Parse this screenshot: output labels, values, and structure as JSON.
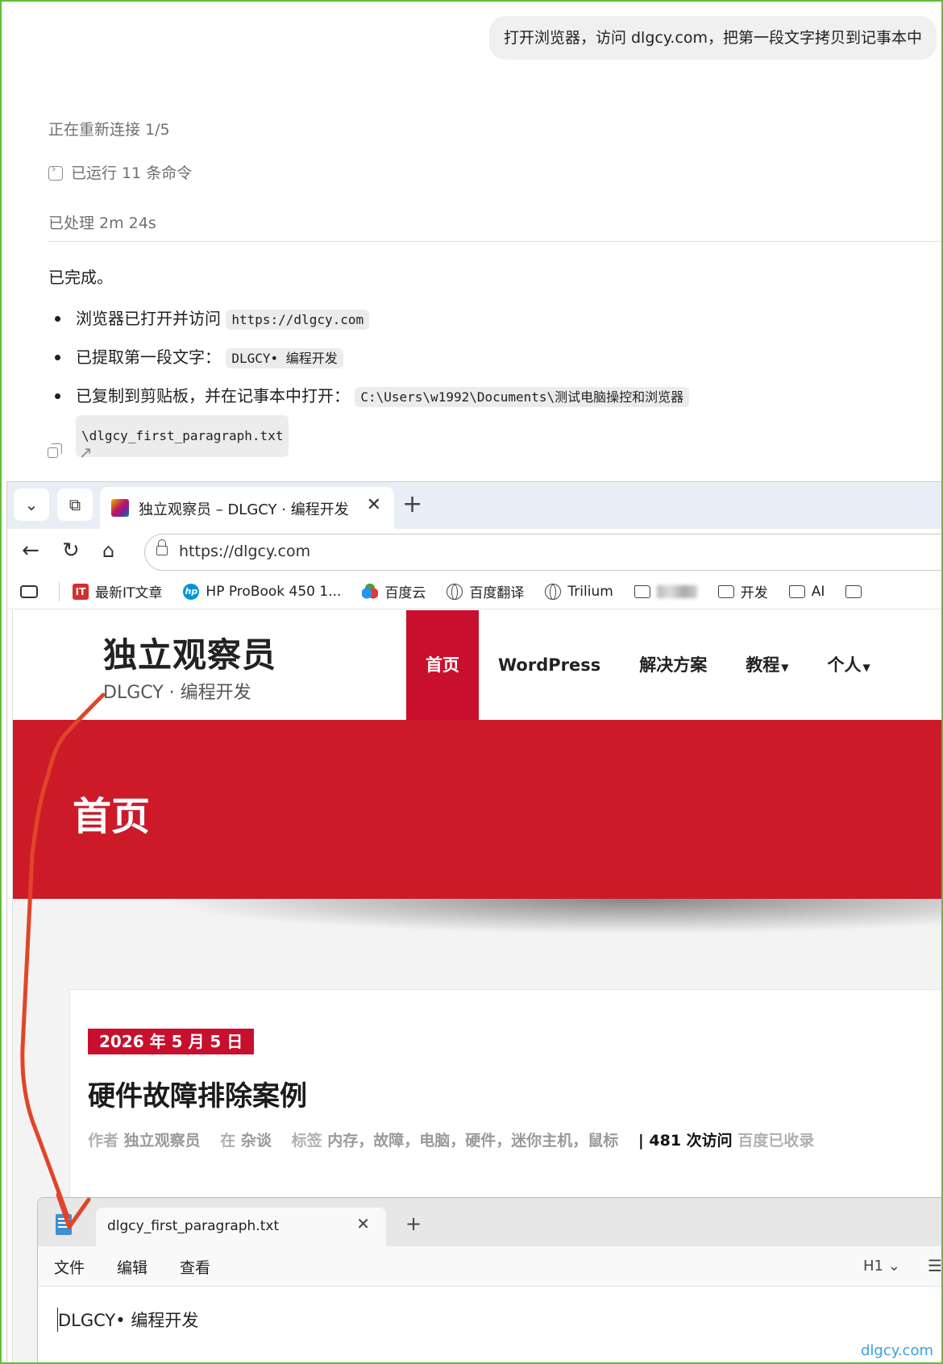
{
  "chat": {
    "user_message": "打开浏览器，访问 dlgcy.com，把第一段文字拷贝到记事本中",
    "reconnecting": "正在重新连接 1/5",
    "commands_ran": "已运行 11 条命令",
    "processed": "已处理 2m 24s",
    "completed": "已完成。",
    "bullets": {
      "b1_text": "浏览器已打开并访问",
      "b1_code": "https://dlgcy.com",
      "b2_text": "已提取第一段文字：",
      "b2_code": "DLGCY• 编程开发",
      "b3_text": "已复制到剪贴板，并在记事本中打开：",
      "b3_code_line1": "C:\\Users\\w1992\\Documents\\测试电脑操控和浏览器",
      "b3_code_line2": "\\dlgcy_first_paragraph.txt"
    }
  },
  "browser": {
    "tab_title": "独立观察员 – DLGCY · 编程开发",
    "new_tab": "+",
    "url": "https://dlgcy.com",
    "bookmarks": [
      "最新IT文章",
      "HP ProBook 450 1...",
      "百度云",
      "百度翻译",
      "Trilium",
      "开发",
      "AI"
    ],
    "icons": {
      "it_icon": "IT",
      "hp_icon": "hp"
    }
  },
  "site": {
    "logo_title": "独立观察员",
    "logo_sub": "DLGCY · 编程开发",
    "menu": [
      "首页",
      "WordPress",
      "解决方案",
      "教程",
      "个人"
    ],
    "banner_title": "首页",
    "post": {
      "date": "2026 年 5 月 5 日",
      "title": "硬件故障排除案例",
      "author_label": "作者",
      "author": "独立观察员",
      "in_label": "在",
      "category": "杂谈",
      "tags_label": "标签",
      "tags": "内存，故障，电脑，硬件，迷你主机，鼠标",
      "views": "| 481 次访问",
      "indexed": "百度已收录"
    },
    "accent_color": "#c8102e"
  },
  "notepad": {
    "tab_title": "dlgcy_first_paragraph.txt",
    "new_tab": "+",
    "menus": [
      "文件",
      "编辑",
      "查看"
    ],
    "heading_select": "H1",
    "content": "DLGCY• 编程开发"
  },
  "watermark": "dlgcy.com"
}
